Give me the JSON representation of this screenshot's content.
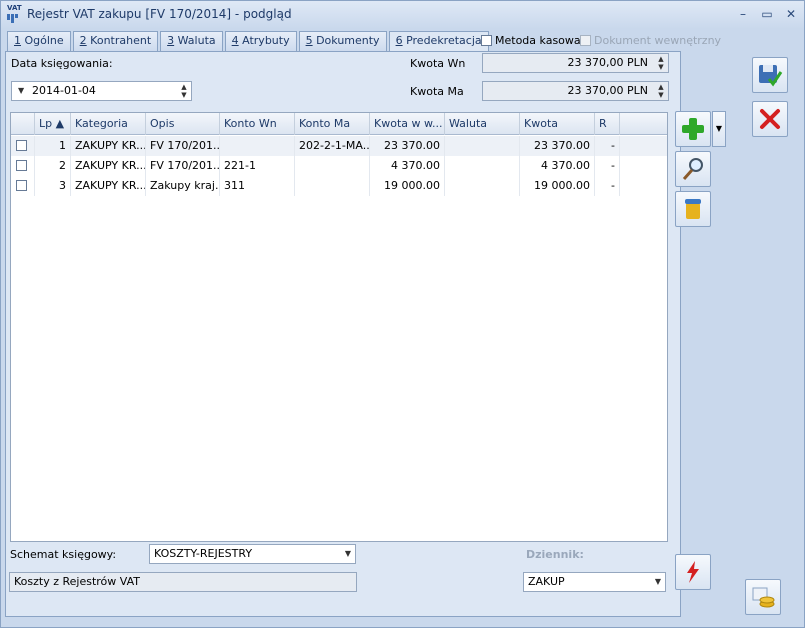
{
  "window": {
    "app_icon_label": "VAT",
    "title": "Rejestr VAT zakupu [FV 170/2014] - podgląd",
    "minimize_glyph": "–",
    "maximize_glyph": "▭",
    "close_glyph": "✕"
  },
  "tabs": [
    {
      "key": "1",
      "label": " Ogólne"
    },
    {
      "key": "2",
      "label": " Kontrahent"
    },
    {
      "key": "3",
      "label": " Waluta"
    },
    {
      "key": "4",
      "label": " Atrybuty"
    },
    {
      "key": "5",
      "label": " Dokumenty"
    },
    {
      "key": "6",
      "label": " Predekretacja"
    }
  ],
  "options": {
    "metoda_kasowa": "Metoda kasowa",
    "dokument_wewnetrzny": "Dokument wewnętrzny"
  },
  "form": {
    "data_label": "Data księgowania:",
    "data_value": "2014-01-04",
    "kwota_wn_label": "Kwota Wn",
    "kwota_wn_value": "23 370,00 PLN",
    "kwota_ma_label": "Kwota Ma",
    "kwota_ma_value": "23 370,00 PLN"
  },
  "grid": {
    "columns": [
      "Lp ▲",
      "Kategoria",
      "Opis",
      "Konto Wn",
      "Konto Ma",
      "Kwota w w...",
      "Waluta",
      "Kwota",
      "R"
    ],
    "rows": [
      {
        "lp": "1",
        "kategoria": "ZAKUPY KR...",
        "opis": "FV 170/201...",
        "konto_wn": "",
        "konto_ma": "202-2-1-MA...",
        "kwota_w": "23 370.00",
        "waluta": "",
        "kwota": "23 370.00",
        "r": "-"
      },
      {
        "lp": "2",
        "kategoria": "ZAKUPY KR...",
        "opis": "FV 170/201...",
        "konto_wn": "221-1",
        "konto_ma": "",
        "kwota_w": "4 370.00",
        "waluta": "",
        "kwota": "4 370.00",
        "r": "-"
      },
      {
        "lp": "3",
        "kategoria": "ZAKUPY KR...",
        "opis": "Zakupy kraj...",
        "konto_wn": "311",
        "konto_ma": "",
        "kwota_w": "19 000.00",
        "waluta": "",
        "kwota": "19 000.00",
        "r": "-"
      }
    ]
  },
  "bottom": {
    "schemat_label": "Schemat księgowy:",
    "schemat_value": "KOSZTY-REJESTRY",
    "schemat_desc": "Koszty z Rejestrów VAT",
    "dziennik_label": "Dziennik:",
    "dziennik_value": "ZAKUP"
  },
  "icons": {
    "save": "save-confirm-icon",
    "cancel": "cancel-icon",
    "add": "add-icon",
    "preview": "magnifier-icon",
    "delete": "trash-bin-icon",
    "post": "lightning-icon",
    "coins": "coins-icon"
  },
  "colors": {
    "accent": "#1e3a68",
    "add_green": "#2fa82a",
    "cancel_red": "#d42020"
  }
}
